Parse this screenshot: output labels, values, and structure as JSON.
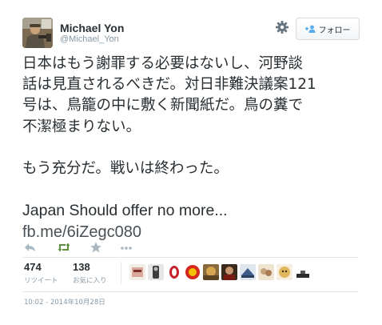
{
  "user": {
    "name": "Michael Yon",
    "handle": "@Michael_Yon"
  },
  "follow_button": {
    "label": "フォロー",
    "icon": "add-user-icon"
  },
  "tweet": {
    "lines": [
      "日本はもう謝罪する必要はないし、河野談",
      "話は見直されるべきだ。対日非難決議案121",
      "号は、鳥籠の中に敷く新聞紙だ。鳥の糞で",
      "不潔極まりない。",
      "",
      "もう充分だ。戦いは終わった。",
      "",
      "Japan Should offer no more..."
    ],
    "link": "fb.me/6iZegc080"
  },
  "actions": [
    "reply-icon",
    "retweet-icon",
    "favorite-icon",
    "more-icon"
  ],
  "stats": {
    "retweets": {
      "count": "474",
      "label": "リツイート"
    },
    "favorites": {
      "count": "138",
      "label": "お気に入り"
    }
  },
  "timestamp": "10:02 - 2014年10月28日",
  "colors": {
    "retweet_green": "#5c913b",
    "icon_gray": "#aab8c2",
    "text": "#292f33",
    "muted": "#8899a6"
  }
}
